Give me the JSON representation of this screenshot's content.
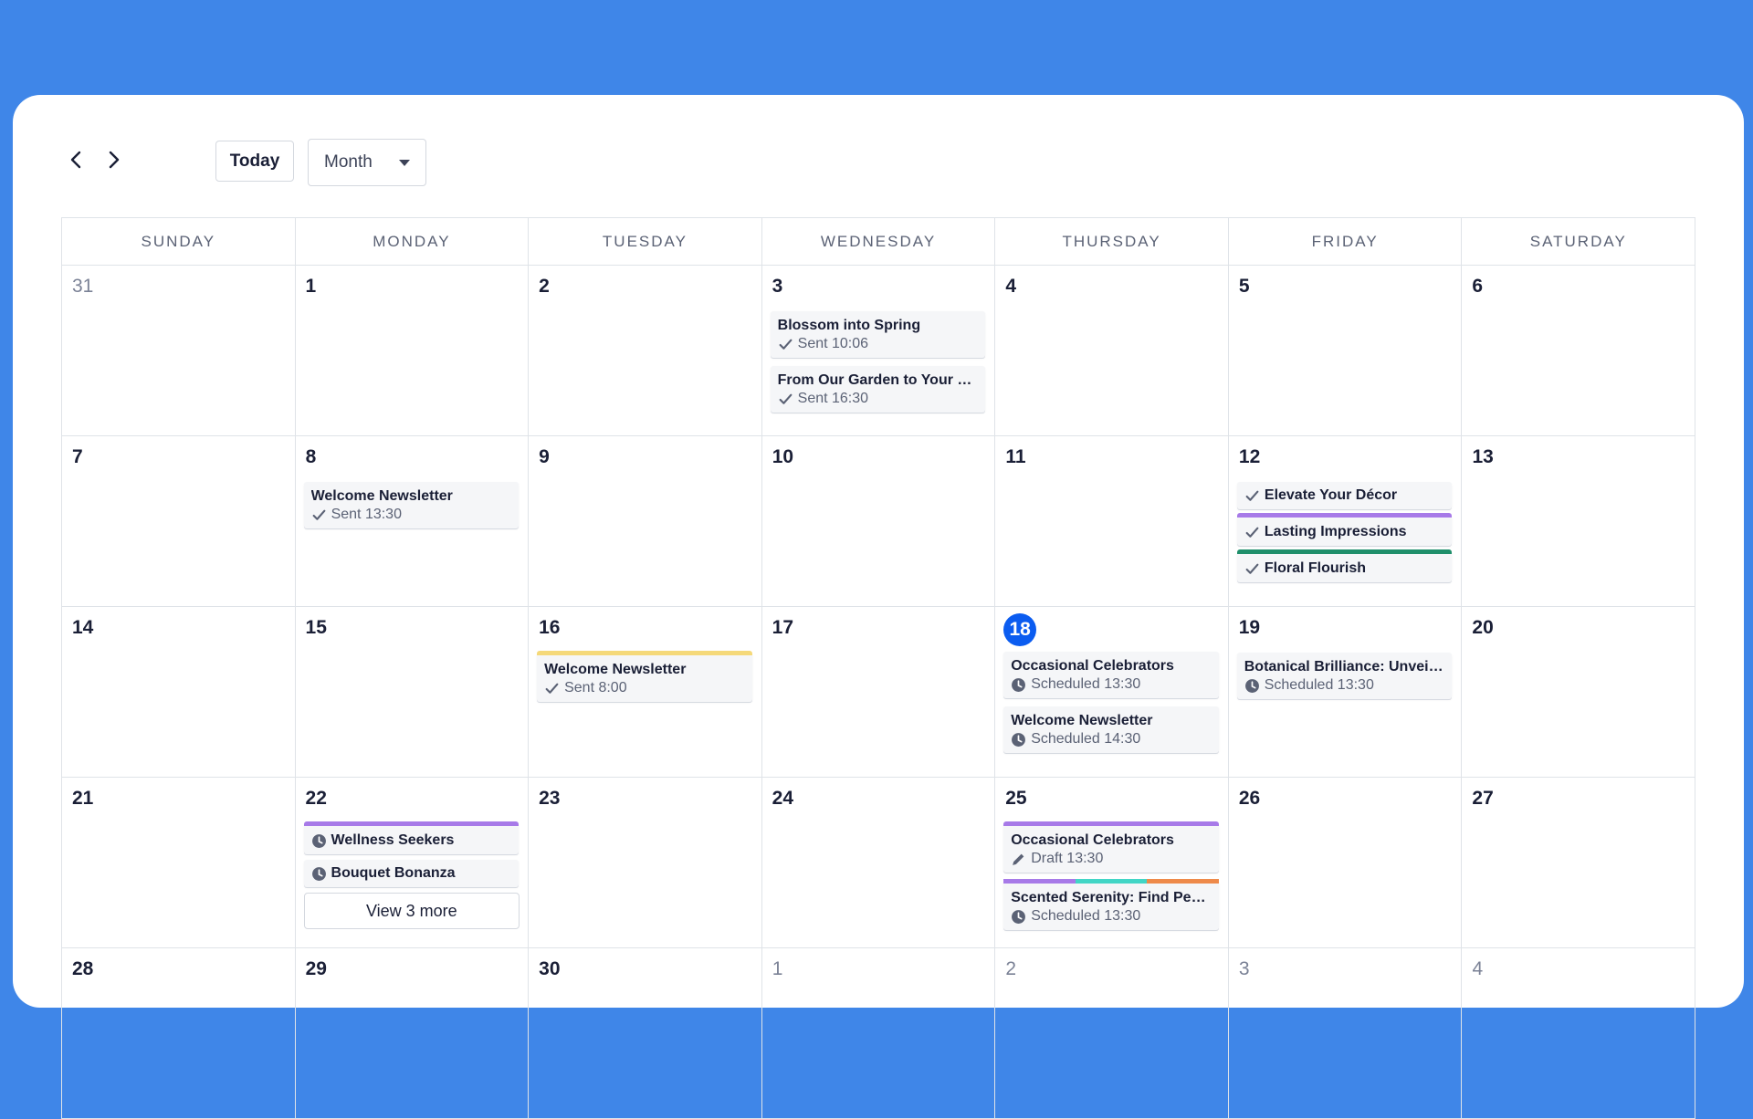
{
  "toolbar": {
    "prev_icon": "chevron-left-icon",
    "next_icon": "chevron-right-icon",
    "today_label": "Today",
    "view_select": {
      "selected": "Month"
    }
  },
  "colors": {
    "background": "#3f86e8",
    "today_circle": "#0b5cf0",
    "purple": "#a77ae8",
    "green": "#1f8f6b",
    "yellow": "#f5d97a",
    "teal": "#42d6c6",
    "orange": "#ee8a4a"
  },
  "weekdays": [
    "SUNDAY",
    "MONDAY",
    "TUESDAY",
    "WEDNESDAY",
    "THURSDAY",
    "FRIDAY",
    "SATURDAY"
  ],
  "weeks": [
    [
      {
        "day": "31",
        "muted": true,
        "events": []
      },
      {
        "day": "1",
        "events": []
      },
      {
        "day": "2",
        "events": []
      },
      {
        "day": "3",
        "events": [
          {
            "title": "Blossom into Spring",
            "status": "Sent 10:06",
            "icon": "check"
          },
          {
            "title": "From Our Garden to Your H...",
            "status": "Sent 16:30",
            "icon": "check"
          }
        ]
      },
      {
        "day": "4",
        "events": []
      },
      {
        "day": "5",
        "events": []
      },
      {
        "day": "6",
        "events": []
      }
    ],
    [
      {
        "day": "7",
        "events": []
      },
      {
        "day": "8",
        "events": [
          {
            "title": "Welcome Newsletter",
            "status": "Sent 13:30",
            "icon": "check"
          }
        ]
      },
      {
        "day": "9",
        "events": []
      },
      {
        "day": "10",
        "events": []
      },
      {
        "day": "11",
        "events": []
      },
      {
        "day": "12",
        "events": [
          {
            "title": "Elevate Your Décor",
            "icon": "check",
            "compact": true
          },
          {
            "title": "Lasting Impressions",
            "icon": "check",
            "compact": true,
            "bar": [
              "#a77ae8"
            ]
          },
          {
            "title": "Floral Flourish",
            "icon": "check",
            "compact": true,
            "bar": [
              "#1f8f6b"
            ]
          }
        ]
      },
      {
        "day": "13",
        "events": []
      }
    ],
    [
      {
        "day": "14",
        "events": []
      },
      {
        "day": "15",
        "events": []
      },
      {
        "day": "16",
        "events": [
          {
            "title": "Welcome Newsletter",
            "status": "Sent 8:00",
            "icon": "check",
            "bar": [
              "#f5d97a"
            ]
          }
        ]
      },
      {
        "day": "17",
        "events": []
      },
      {
        "day": "18",
        "today": true,
        "events": [
          {
            "title": "Occasional Celebrators",
            "status": "Scheduled 13:30",
            "icon": "clock"
          },
          {
            "title": "Welcome Newsletter",
            "status": "Scheduled 14:30",
            "icon": "clock"
          }
        ]
      },
      {
        "day": "19",
        "events": [
          {
            "title": "Botanical Brilliance: Unveili...",
            "status": "Scheduled 13:30",
            "icon": "clock"
          }
        ]
      },
      {
        "day": "20",
        "events": []
      }
    ],
    [
      {
        "day": "21",
        "events": []
      },
      {
        "day": "22",
        "events": [
          {
            "title": "Wellness Seekers",
            "icon": "clock",
            "compact": true,
            "bar": [
              "#a77ae8"
            ]
          },
          {
            "title": "Bouquet Bonanza",
            "icon": "clock",
            "compact": true
          }
        ],
        "more": "View 3 more"
      },
      {
        "day": "23",
        "events": []
      },
      {
        "day": "24",
        "events": []
      },
      {
        "day": "25",
        "events": [
          {
            "title": "Occasional Celebrators",
            "status": "Draft 13:30",
            "icon": "pencil",
            "bar": [
              "#a77ae8"
            ]
          },
          {
            "title": "Scented Serenity: Find Peace...",
            "status": "Scheduled 13:30",
            "icon": "clock",
            "bar": [
              "#a77ae8",
              "#42d6c6",
              "#ee8a4a"
            ]
          }
        ]
      },
      {
        "day": "26",
        "events": []
      },
      {
        "day": "27",
        "events": []
      }
    ],
    [
      {
        "day": "28",
        "events": []
      },
      {
        "day": "29",
        "events": []
      },
      {
        "day": "30",
        "events": []
      },
      {
        "day": "1",
        "muted": true,
        "events": []
      },
      {
        "day": "2",
        "muted": true,
        "events": []
      },
      {
        "day": "3",
        "muted": true,
        "events": []
      },
      {
        "day": "4",
        "muted": true,
        "events": []
      }
    ]
  ]
}
